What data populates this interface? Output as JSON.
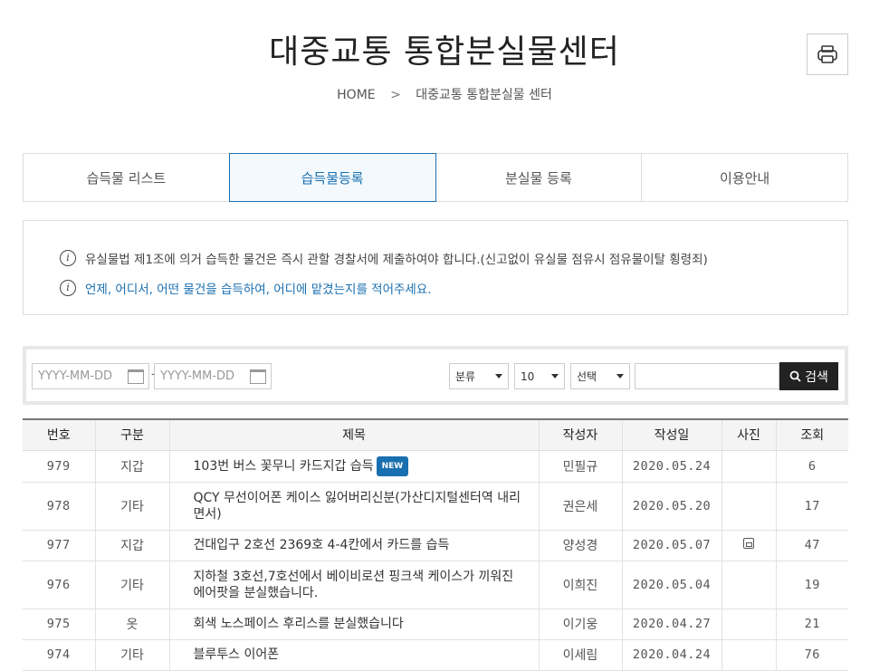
{
  "header": {
    "title": "대중교통 통합분실물센터",
    "print_icon": "printer-icon"
  },
  "breadcrumb": {
    "home": "HOME",
    "separator": ">",
    "current": "대중교통 통합분실물 센터"
  },
  "tabs": [
    {
      "label": "습득물 리스트",
      "active": false
    },
    {
      "label": "습득물등록",
      "active": true
    },
    {
      "label": "분실물 등록",
      "active": false
    },
    {
      "label": "이용안내",
      "active": false
    }
  ],
  "notice": {
    "line1": "유실물법 제1조에 의거 습득한 물건은 즉시 관할 경찰서에 제출하여야 합니다.(신고없이 유실물 점유시 점유물이탈 횡령죄)",
    "line2": "언제, 어디서, 어떤 물건을 습득하여, 어디에 맡겼는지를 적어주세요.",
    "info_glyph": "i",
    "accent_color": "#1a6fb0"
  },
  "search": {
    "date_from_placeholder": "YYYY-MM-DD",
    "date_to_placeholder": "YYYY-MM-DD",
    "date_separator": "-",
    "category_selected": "분류",
    "page_size_selected": "10",
    "field_selected": "선택",
    "keyword_value": "",
    "button_label": "검색"
  },
  "table": {
    "headers": [
      "번호",
      "구분",
      "제목",
      "작성자",
      "작성일",
      "사진",
      "조회"
    ],
    "new_badge": "NEW",
    "rows": [
      {
        "no": "979",
        "category": "지갑",
        "subject": "103번 버스 꽃무니 카드지갑 습득",
        "is_new": true,
        "author": "민필규",
        "date": "2020.05.24",
        "has_photo": false,
        "views": "6"
      },
      {
        "no": "978",
        "category": "기타",
        "subject": "QCY 무선이어폰 케이스 잃어버리신분(가산디지털센터역 내리면서)",
        "is_new": false,
        "author": "권은세",
        "date": "2020.05.20",
        "has_photo": false,
        "views": "17"
      },
      {
        "no": "977",
        "category": "지갑",
        "subject": "건대입구 2호선 2369호 4-4칸에서 카드를 습득",
        "is_new": false,
        "author": "양성경",
        "date": "2020.05.07",
        "has_photo": true,
        "views": "47"
      },
      {
        "no": "976",
        "category": "기타",
        "subject": "지하철 3호선,7호선에서 베이비로션 핑크색 케이스가 끼워진 에어팟을 분실했습니다.",
        "is_new": false,
        "author": "이희진",
        "date": "2020.05.04",
        "has_photo": false,
        "views": "19"
      },
      {
        "no": "975",
        "category": "옷",
        "subject": "회색 노스페이스 후리스를 분실했습니다",
        "is_new": false,
        "author": "이기웅",
        "date": "2020.04.27",
        "has_photo": false,
        "views": "21"
      },
      {
        "no": "974",
        "category": "기타",
        "subject": "블루투스 이어폰",
        "is_new": false,
        "author": "이세림",
        "date": "2020.04.24",
        "has_photo": false,
        "views": "76"
      }
    ]
  }
}
